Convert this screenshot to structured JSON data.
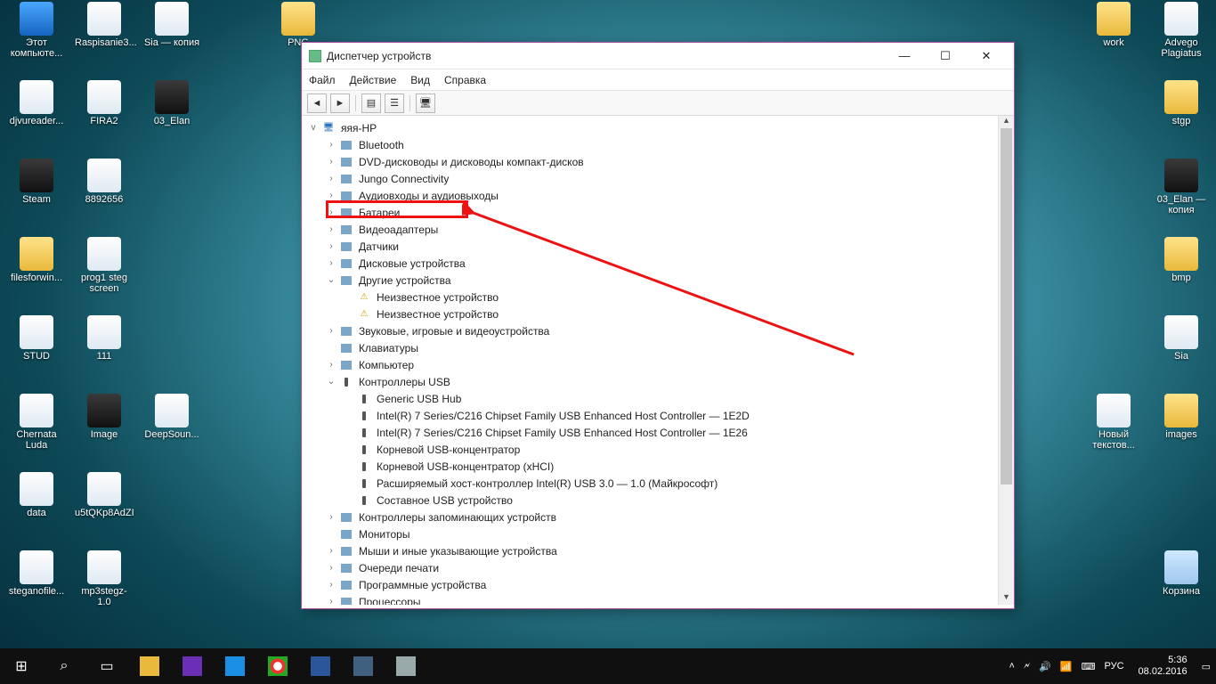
{
  "desktop_icons": {
    "col1": [
      {
        "label": "Этот компьюте...",
        "cls": "blue"
      },
      {
        "label": "djvureader...",
        "cls": ""
      },
      {
        "label": "Steam",
        "cls": "dark"
      },
      {
        "label": "filesforwin...",
        "cls": "folder"
      },
      {
        "label": "STUD",
        "cls": ""
      },
      {
        "label": "Chernata Luda",
        "cls": ""
      },
      {
        "label": "data",
        "cls": ""
      },
      {
        "label": "steganofile...",
        "cls": ""
      }
    ],
    "col2": [
      {
        "label": "Raspisanie3...",
        "cls": ""
      },
      {
        "label": "FIRA2",
        "cls": ""
      },
      {
        "label": "8892656",
        "cls": ""
      },
      {
        "label": "prog1 steg screen",
        "cls": ""
      },
      {
        "label": "111",
        "cls": ""
      },
      {
        "label": "Image",
        "cls": "dark"
      },
      {
        "label": "u5tQKp8AdZI",
        "cls": ""
      },
      {
        "label": "mp3stegz-1.0",
        "cls": ""
      }
    ],
    "col3": [
      {
        "label": "Sia — копия",
        "cls": ""
      },
      {
        "label": "03_Elan",
        "cls": "dark"
      },
      {
        "label": "",
        "cls": ""
      },
      {
        "label": "",
        "cls": ""
      },
      {
        "label": "",
        "cls": ""
      },
      {
        "label": "DeepSoun...",
        "cls": ""
      }
    ],
    "col5": [
      {
        "label": "PNG",
        "cls": "folder"
      }
    ],
    "right1": [
      {
        "label": "work",
        "cls": "folder"
      },
      {
        "label": "",
        "cls": ""
      },
      {
        "label": "",
        "cls": ""
      },
      {
        "label": "",
        "cls": ""
      },
      {
        "label": "",
        "cls": ""
      },
      {
        "label": "Новый текстов...",
        "cls": ""
      }
    ],
    "right2": [
      {
        "label": "Advego Plagiatus",
        "cls": ""
      },
      {
        "label": "stgp",
        "cls": "folder"
      },
      {
        "label": "03_Elan — копия",
        "cls": "dark"
      },
      {
        "label": "bmp",
        "cls": "folder"
      },
      {
        "label": "Sia",
        "cls": ""
      },
      {
        "label": "images",
        "cls": "folder"
      },
      {
        "label": "",
        "cls": ""
      },
      {
        "label": "Корзина",
        "cls": "recycle"
      }
    ]
  },
  "window": {
    "title": "Диспетчер устройств",
    "menus": [
      "Файл",
      "Действие",
      "Вид",
      "Справка"
    ],
    "toolbar": [
      "◄",
      "►",
      "⯊",
      "⯐",
      "🖵",
      "❓",
      "🖥"
    ],
    "root": "яяя-HP",
    "tree": [
      {
        "d": 1,
        "t": ">",
        "i": "i-gen",
        "l": "Bluetooth"
      },
      {
        "d": 1,
        "t": ">",
        "i": "i-gen",
        "l": "DVD-дисководы и дисководы компакт-дисков"
      },
      {
        "d": 1,
        "t": ">",
        "i": "i-gen",
        "l": "Jungo Connectivity"
      },
      {
        "d": 1,
        "t": ">",
        "i": "i-gen",
        "l": "Аудиовходы и аудиовыходы"
      },
      {
        "d": 1,
        "t": ">",
        "i": "i-gen",
        "l": "Батареи"
      },
      {
        "d": 1,
        "t": ">",
        "i": "i-gen",
        "l": "Видеоадаптеры",
        "hl": true
      },
      {
        "d": 1,
        "t": ">",
        "i": "i-gen",
        "l": "Датчики"
      },
      {
        "d": 1,
        "t": ">",
        "i": "i-gen",
        "l": "Дисковые устройства"
      },
      {
        "d": 1,
        "t": "v",
        "i": "i-gen",
        "l": "Другие устройства"
      },
      {
        "d": 2,
        "t": "",
        "i": "i-warn",
        "l": "Неизвестное устройство"
      },
      {
        "d": 2,
        "t": "",
        "i": "i-warn",
        "l": "Неизвестное устройство"
      },
      {
        "d": 1,
        "t": ">",
        "i": "i-gen",
        "l": "Звуковые, игровые и видеоустройства"
      },
      {
        "d": 1,
        "t": "",
        "i": "i-gen",
        "l": "Клавиатуры"
      },
      {
        "d": 1,
        "t": ">",
        "i": "i-gen",
        "l": "Компьютер"
      },
      {
        "d": 1,
        "t": "v",
        "i": "i-usb",
        "l": "Контроллеры USB"
      },
      {
        "d": 2,
        "t": "",
        "i": "i-usb",
        "l": "Generic USB Hub"
      },
      {
        "d": 2,
        "t": "",
        "i": "i-usb",
        "l": "Intel(R) 7 Series/C216 Chipset Family USB Enhanced Host Controller — 1E2D"
      },
      {
        "d": 2,
        "t": "",
        "i": "i-usb",
        "l": "Intel(R) 7 Series/C216 Chipset Family USB Enhanced Host Controller — 1E26"
      },
      {
        "d": 2,
        "t": "",
        "i": "i-usb",
        "l": "Корневой USB-концентратор"
      },
      {
        "d": 2,
        "t": "",
        "i": "i-usb",
        "l": "Корневой USB-концентратор (xHCI)"
      },
      {
        "d": 2,
        "t": "",
        "i": "i-usb",
        "l": "Расширяемый хост-контроллер Intel(R) USB 3.0 — 1.0 (Майкрософт)"
      },
      {
        "d": 2,
        "t": "",
        "i": "i-usb",
        "l": "Составное USB устройство"
      },
      {
        "d": 1,
        "t": ">",
        "i": "i-gen",
        "l": "Контроллеры запоминающих устройств"
      },
      {
        "d": 1,
        "t": "",
        "i": "i-gen",
        "l": "Мониторы"
      },
      {
        "d": 1,
        "t": ">",
        "i": "i-gen",
        "l": "Мыши и иные указывающие устройства"
      },
      {
        "d": 1,
        "t": ">",
        "i": "i-gen",
        "l": "Очереди печати"
      },
      {
        "d": 1,
        "t": ">",
        "i": "i-gen",
        "l": "Программные устройства"
      },
      {
        "d": 1,
        "t": ">",
        "i": "i-gen",
        "l": "Процессоры"
      }
    ]
  },
  "taskbar": {
    "tray": {
      "lang": "РУС",
      "time": "5:36",
      "date": "08.02.2016"
    }
  }
}
